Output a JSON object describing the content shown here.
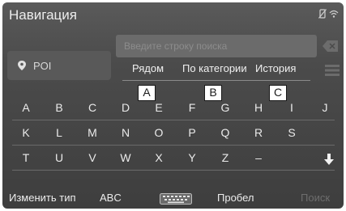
{
  "header": {
    "title": "Навигация"
  },
  "search": {
    "placeholder": "Введите строку поиска"
  },
  "poi": {
    "label": "POI"
  },
  "tabs": [
    {
      "label": "Рядом"
    },
    {
      "label": "По категории"
    },
    {
      "label": "История"
    }
  ],
  "callouts": [
    "A",
    "B",
    "C"
  ],
  "keyboard": {
    "row1": [
      "A",
      "B",
      "C",
      "D",
      "E",
      "F",
      "G",
      "H",
      "I",
      "J"
    ],
    "row2": [
      "K",
      "L",
      "M",
      "N",
      "O",
      "P",
      "Q",
      "R",
      "S"
    ],
    "row3": [
      "T",
      "U",
      "V",
      "W",
      "X",
      "Y",
      "Z",
      "–"
    ]
  },
  "bottom": {
    "change_type": "Изменить тип",
    "abc": "ABC",
    "space": "Пробел",
    "search": "Поиск"
  },
  "icons": {
    "location": "location-pin-icon",
    "backspace": "backspace-icon",
    "list": "list-icon",
    "keyboard": "keyboard-icon",
    "down": "arrow-down-icon",
    "no_phone": "no-phone-icon",
    "wifi": "wifi-icon"
  },
  "colors": {
    "background": "#4b4b4b",
    "text": "#ececec",
    "dim_text": "#8c8c8c"
  }
}
